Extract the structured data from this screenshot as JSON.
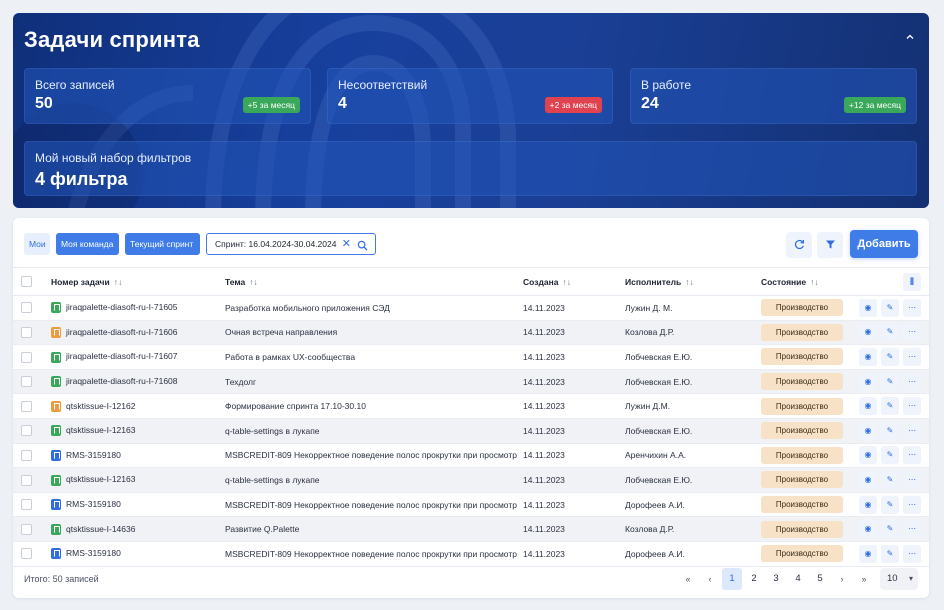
{
  "hero": {
    "title": "Задачи спринта",
    "stats": [
      {
        "label": "Всего записей",
        "value": "50",
        "badge": "+5 за месяц",
        "badge_kind": "green"
      },
      {
        "label": "Несоответствий",
        "value": "4",
        "badge": "+2 за месяц",
        "badge_kind": "red"
      },
      {
        "label": "В работе",
        "value": "24",
        "badge": "+12 за месяц",
        "badge_kind": "green"
      }
    ],
    "filter_set": {
      "label": "Мой новый набор фильтров",
      "value": "4 фильтра"
    }
  },
  "toolbar": {
    "chips": [
      "Мои",
      "Моя команда",
      "Текущий спринт"
    ],
    "sprint_filter": "Спринт: 16.04.2024-30.04.2024",
    "add_label": "Добавить"
  },
  "table": {
    "headers": [
      "Номер задачи",
      "Тема",
      "Создана",
      "Исполнитель",
      "Состояние"
    ],
    "rows": [
      {
        "icon": "green",
        "key": "jiraqpalette-diasoft-ru-I-71605",
        "subject": "Разработка мобильного приложения СЭД",
        "created": "14.11.2023",
        "assignee": "Лужин Д. М.",
        "status": "Производство"
      },
      {
        "icon": "orange",
        "key": "jiraqpalette-diasoft-ru-I-71606",
        "subject": "Очная встреча направления",
        "created": "14.11.2023",
        "assignee": "Козлова Д.Р.",
        "status": "Производство"
      },
      {
        "icon": "green",
        "key": "jiraqpalette-diasoft-ru-I-71607",
        "subject": "Работа в рамках UX-сообщества",
        "created": "14.11.2023",
        "assignee": "Лобчевская Е.Ю.",
        "status": "Производство"
      },
      {
        "icon": "green",
        "key": "jiraqpalette-diasoft-ru-I-71608",
        "subject": "Техдолг",
        "created": "14.11.2023",
        "assignee": "Лобчевская Е.Ю.",
        "status": "Производство"
      },
      {
        "icon": "orange",
        "key": "qtsktissue-I-12162",
        "subject": "Формирование спринта 17.10-30.10",
        "created": "14.11.2023",
        "assignee": "Лужин Д.М.",
        "status": "Производство"
      },
      {
        "icon": "green",
        "key": "qtsktissue-I-12163",
        "subject": "q-table-settings в лукапе",
        "created": "14.11.2023",
        "assignee": "Лобчевская Е.Ю.",
        "status": "Производство"
      },
      {
        "icon": "blue",
        "key": "RMS-3159180",
        "subject": "MSBCREDIT-809 Некорректное поведение полос прокрутки при просмотр",
        "created": "14.11.2023",
        "assignee": "Аренчихин А.А.",
        "status": "Производство"
      },
      {
        "icon": "green",
        "key": "qtsktissue-I-12163",
        "subject": "q-table-settings в лукапе",
        "created": "14.11.2023",
        "assignee": "Лобчевская Е.Ю.",
        "status": "Производство"
      },
      {
        "icon": "blue",
        "key": "RMS-3159180",
        "subject": "MSBCREDIT-809 Некорректное поведение полос прокрутки при просмотр",
        "created": "14.11.2023",
        "assignee": "Дорофеев А.И.",
        "status": "Производство"
      },
      {
        "icon": "green",
        "key": "qtsktissue-I-14636",
        "subject": "Развитие Q.Palette",
        "created": "14.11.2023",
        "assignee": "Козлова Д.Р.",
        "status": "Производство"
      },
      {
        "icon": "blue",
        "key": "RMS-3159180",
        "subject": "MSBCREDIT-809 Некорректное поведение полос прокрутки при просмотр",
        "created": "14.11.2023",
        "assignee": "Дорофеев А.И.",
        "status": "Производство"
      }
    ]
  },
  "footer": {
    "total": "Итого: 50 записей",
    "pages": [
      "1",
      "2",
      "3",
      "4",
      "5"
    ],
    "per_page": "10"
  },
  "colors": {
    "accent": "#3f7ce8",
    "hero": "#17409e",
    "status_bg": "#f7e2c7"
  }
}
